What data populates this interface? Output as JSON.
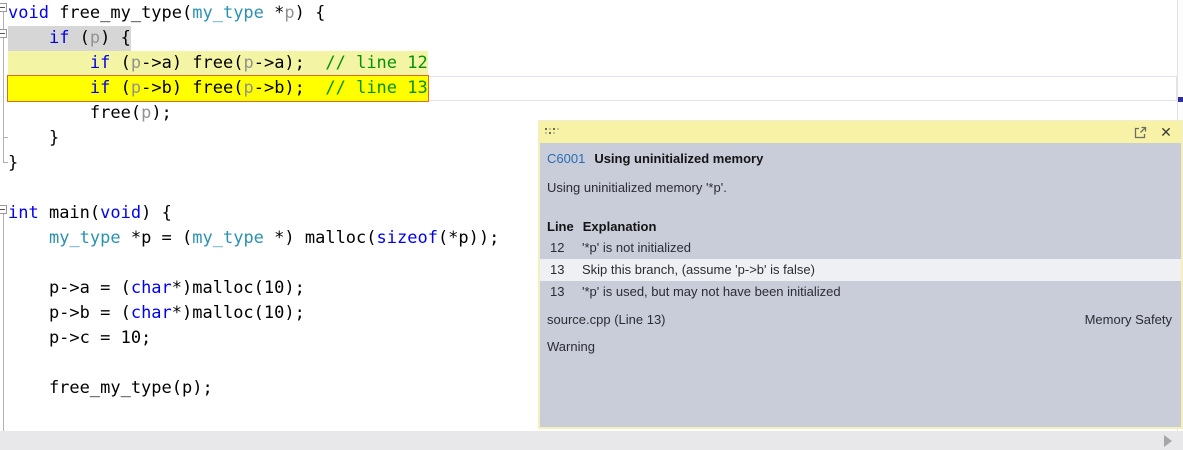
{
  "editor": {
    "code_lines": [
      {
        "tokens": [
          {
            "t": "void",
            "c": "kw"
          },
          {
            "t": " free_my_type(",
            "c": "pl"
          },
          {
            "t": "my_type",
            "c": "ty"
          },
          {
            "t": " *",
            "c": "pl"
          },
          {
            "t": "p",
            "c": "pm"
          },
          {
            "t": ") {",
            "c": "pl"
          }
        ]
      },
      {
        "highlight": "gray",
        "tokens": [
          {
            "t": "    ",
            "c": "pl"
          },
          {
            "t": "if",
            "c": "kw"
          },
          {
            "t": " (",
            "c": "pl"
          },
          {
            "t": "p",
            "c": "pm"
          },
          {
            "t": ") {",
            "c": "pl"
          }
        ]
      },
      {
        "highlight": "pale",
        "tokens": [
          {
            "t": "        ",
            "c": "pl"
          },
          {
            "t": "if",
            "c": "kw"
          },
          {
            "t": " (",
            "c": "pl"
          },
          {
            "t": "p",
            "c": "pm"
          },
          {
            "t": "->a) free(",
            "c": "pl"
          },
          {
            "t": "p",
            "c": "pm"
          },
          {
            "t": "->a);  ",
            "c": "pl"
          },
          {
            "t": "// line 12",
            "c": "cm"
          }
        ]
      },
      {
        "highlight": "yellow",
        "tokens": [
          {
            "t": "        ",
            "c": "pl"
          },
          {
            "t": "if",
            "c": "kw"
          },
          {
            "t": " (",
            "c": "pl"
          },
          {
            "t": "p",
            "c": "pm"
          },
          {
            "t": "->b) free(",
            "c": "pl"
          },
          {
            "t": "p",
            "c": "pm"
          },
          {
            "t": "->b);  ",
            "c": "pl"
          },
          {
            "t": "// line 13",
            "c": "cm"
          }
        ]
      },
      {
        "tokens": [
          {
            "t": "        free(",
            "c": "pl"
          },
          {
            "t": "p",
            "c": "pm"
          },
          {
            "t": ");",
            "c": "pl"
          }
        ]
      },
      {
        "tokens": [
          {
            "t": "    }",
            "c": "pl"
          }
        ]
      },
      {
        "tokens": [
          {
            "t": "}",
            "c": "pl"
          }
        ]
      },
      {
        "tokens": []
      },
      {
        "tokens": [
          {
            "t": "int",
            "c": "kw"
          },
          {
            "t": " main(",
            "c": "pl"
          },
          {
            "t": "void",
            "c": "kw"
          },
          {
            "t": ") {",
            "c": "pl"
          }
        ]
      },
      {
        "tokens": [
          {
            "t": "    ",
            "c": "pl"
          },
          {
            "t": "my_type",
            "c": "ty"
          },
          {
            "t": " *p = (",
            "c": "pl"
          },
          {
            "t": "my_type",
            "c": "ty"
          },
          {
            "t": " *) malloc(",
            "c": "pl"
          },
          {
            "t": "sizeof",
            "c": "kw"
          },
          {
            "t": "(*p));",
            "c": "pl"
          }
        ]
      },
      {
        "tokens": []
      },
      {
        "tokens": [
          {
            "t": "    p->a = (",
            "c": "pl"
          },
          {
            "t": "char",
            "c": "kw"
          },
          {
            "t": "*)malloc(10);",
            "c": "pl"
          }
        ]
      },
      {
        "tokens": [
          {
            "t": "    p->b = (",
            "c": "pl"
          },
          {
            "t": "char",
            "c": "kw"
          },
          {
            "t": "*)malloc(10);",
            "c": "pl"
          }
        ]
      },
      {
        "tokens": [
          {
            "t": "    p->c = 10;",
            "c": "pl"
          }
        ]
      },
      {
        "tokens": []
      },
      {
        "tokens": [
          {
            "t": "    free_my_type(p);",
            "c": "pl"
          }
        ]
      }
    ]
  },
  "popup": {
    "titlebar": {
      "close_glyph": "✕"
    },
    "code": "C6001",
    "title": "Using uninitialized memory",
    "description": "Using uninitialized memory '*p'.",
    "table": {
      "col1": "Line",
      "col2": "Explanation",
      "rows": [
        {
          "line": "12",
          "text": "'*p' is not initialized",
          "highlighted": false
        },
        {
          "line": "13",
          "text": "Skip this branch, (assume 'p->b' is false)",
          "highlighted": true
        },
        {
          "line": "13",
          "text": "'*p' is used, but may not have been initialized",
          "highlighted": false
        }
      ]
    },
    "footer": {
      "location": "source.cpp (Line 13)",
      "category": "Memory Safety",
      "severity": "Warning"
    }
  },
  "colors": {
    "keyword": "#0000ee",
    "type": "#2b91af",
    "comment": "#069109",
    "line12_highlight": "#f4f5a4",
    "line13_highlight": "#ffff00",
    "line13_border": "#e06c24",
    "selection_gray": "#d6d6d6",
    "popup_header": "#f8f2a6",
    "popup_body": "#c9ccd9",
    "rule_code_blue": "#2a6cb4"
  }
}
